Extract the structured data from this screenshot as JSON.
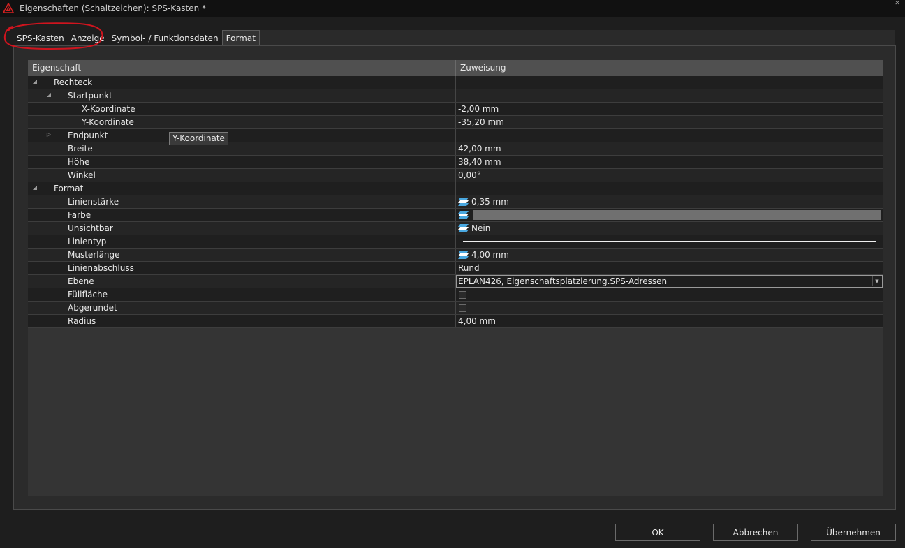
{
  "window": {
    "title": "Eigenschaften (Schaltzeichen): SPS-Kasten *",
    "close_symbol": "✕"
  },
  "tabs": [
    {
      "label": "SPS-Kasten",
      "active": false
    },
    {
      "label": "Anzeige",
      "active": false
    },
    {
      "label": "Symbol- / Funktionsdaten",
      "active": false
    },
    {
      "label": "Format",
      "active": true
    }
  ],
  "grid": {
    "columns": [
      "Eigenschaft",
      "Zuweisung"
    ],
    "rows": [
      {
        "name": "Rechteck",
        "value": "",
        "expander": "expanded",
        "kind": "text"
      },
      {
        "name": "Startpunkt",
        "value": "",
        "expander": "expanded",
        "kind": "text"
      },
      {
        "name": "X-Koordinate",
        "value": "-2,00 mm",
        "expander": "none",
        "kind": "text"
      },
      {
        "name": "Y-Koordinate",
        "value": "-35,20 mm",
        "expander": "none",
        "kind": "text"
      },
      {
        "name": "Endpunkt",
        "value": "",
        "expander": "collapsed",
        "kind": "text"
      },
      {
        "name": "Breite",
        "value": "42,00 mm",
        "expander": "none",
        "kind": "text"
      },
      {
        "name": "Höhe",
        "value": "38,40 mm",
        "expander": "none",
        "kind": "text"
      },
      {
        "name": "Winkel",
        "value": "0,00°",
        "expander": "none",
        "kind": "text"
      },
      {
        "name": "Format",
        "value": "",
        "expander": "expanded",
        "kind": "text"
      },
      {
        "name": "Linienstärke",
        "value": "0,35 mm",
        "expander": "none",
        "kind": "layer"
      },
      {
        "name": "Farbe",
        "value": "",
        "expander": "none",
        "kind": "color",
        "color": "#707070"
      },
      {
        "name": "Unsichtbar",
        "value": "Nein",
        "expander": "none",
        "kind": "layer"
      },
      {
        "name": "Linientyp",
        "value": "",
        "expander": "none",
        "kind": "linetype"
      },
      {
        "name": "Musterlänge",
        "value": "4,00 mm",
        "expander": "none",
        "kind": "layer"
      },
      {
        "name": "Linienabschluss",
        "value": "Rund",
        "expander": "none",
        "kind": "text"
      },
      {
        "name": "Ebene",
        "value": "EPLAN426, Eigenschaftsplatzierung.SPS-Adressen",
        "expander": "none",
        "kind": "dropdown"
      },
      {
        "name": "Füllfläche",
        "value": "",
        "expander": "none",
        "kind": "checkbox",
        "checked": false
      },
      {
        "name": "Abgerundet",
        "value": "",
        "expander": "none",
        "kind": "checkbox",
        "checked": false
      },
      {
        "name": "Radius",
        "value": "4,00 mm",
        "expander": "none",
        "kind": "text"
      }
    ]
  },
  "tooltip": {
    "text": "Y-Koordinate"
  },
  "buttons": {
    "ok": "OK",
    "cancel": "Abbrechen",
    "apply": "Übernehmen"
  },
  "colors": {
    "annotation": "#d0141e",
    "app_icon": "#d42020",
    "layer_icon": "#4aa8e0"
  },
  "icons": {
    "app": "eplan-app-icon",
    "expanded": "expanded-triangle-icon",
    "collapsed": "collapsed-triangle-icon",
    "layer": "layer-stack-icon",
    "dropdown": "chevron-down-icon"
  }
}
